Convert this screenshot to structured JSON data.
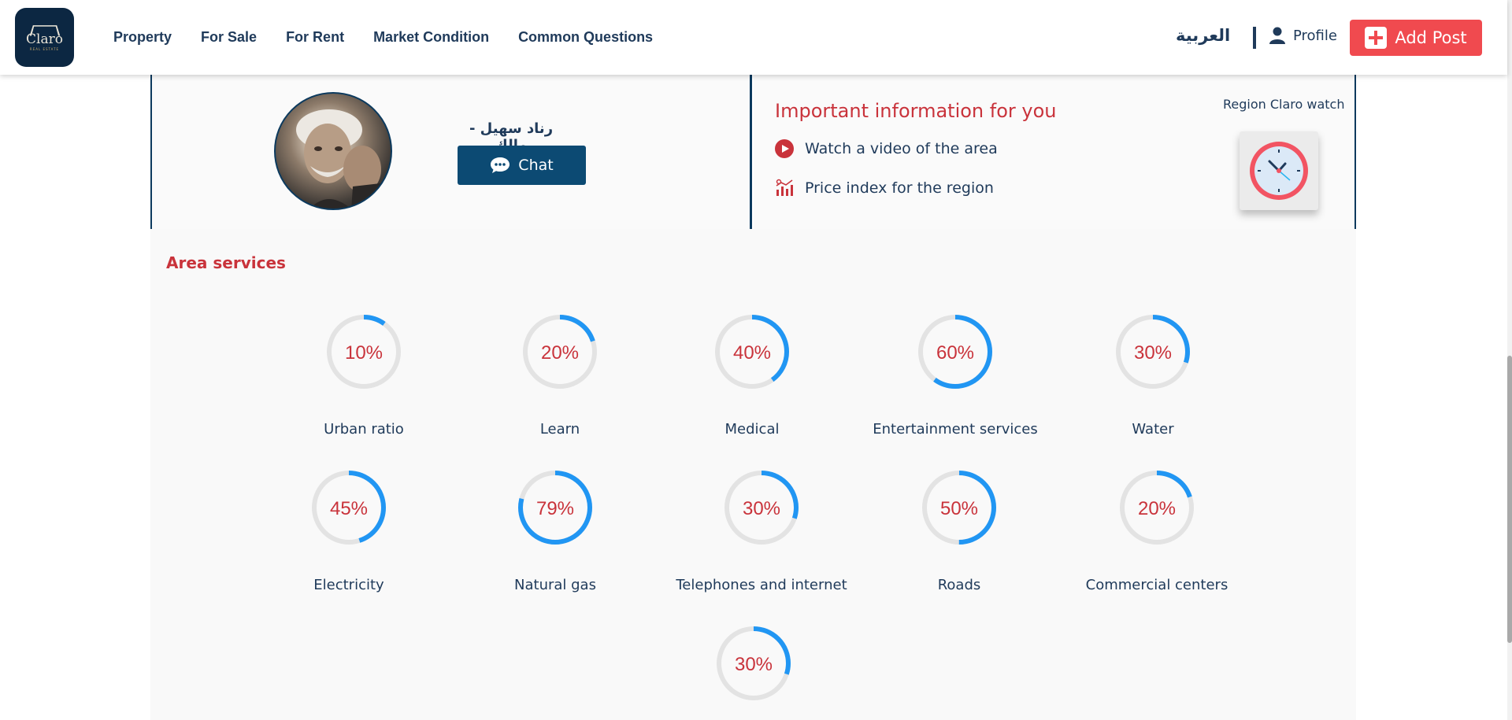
{
  "header": {
    "logo_text": "Claro",
    "logo_sub": "REAL ESTATE",
    "nav": [
      "Property",
      "For Sale",
      "For Rent",
      "Market Condition",
      "Common Questions"
    ],
    "language": "العربية",
    "profile_label": "Profile",
    "add_post_label": "Add Post"
  },
  "owner": {
    "name": "رناد سهيل - مالك",
    "chat_label": "Chat"
  },
  "info": {
    "title": "Important information for you",
    "video_label": "Watch a video of the area",
    "price_index_label": "Price index for the region",
    "region_watch_label": "Region Claro watch"
  },
  "services": {
    "title": "Area services",
    "items": [
      {
        "label": "Urban ratio",
        "value": 10
      },
      {
        "label": "Learn",
        "value": 20
      },
      {
        "label": "Medical",
        "value": 40
      },
      {
        "label": "Entertainment services",
        "value": 60
      },
      {
        "label": "Water",
        "value": 30
      },
      {
        "label": "Electricity",
        "value": 45
      },
      {
        "label": "Natural gas",
        "value": 79
      },
      {
        "label": "Telephones and internet",
        "value": 30
      },
      {
        "label": "Roads",
        "value": 50
      },
      {
        "label": "Commercial centers",
        "value": 20
      },
      {
        "label": "",
        "value": 30
      }
    ]
  },
  "colors": {
    "navy": "#1f3a5a",
    "accent_red": "#c9333b",
    "button_red": "#f04a4f",
    "progress_blue": "#2196f3",
    "track_gray": "#e3e3e3"
  }
}
